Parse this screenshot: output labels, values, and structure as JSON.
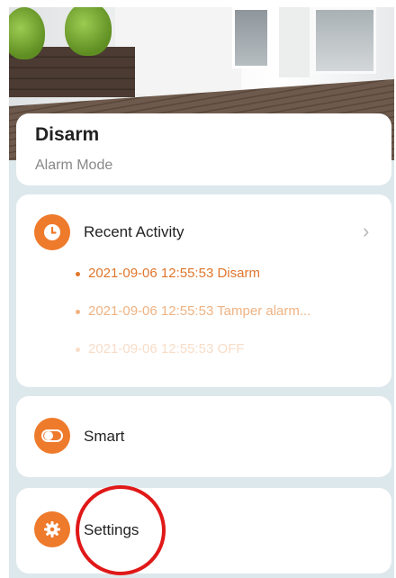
{
  "alarm": {
    "mode_value": "Disarm",
    "mode_label": "Alarm Mode"
  },
  "recent_activity": {
    "title": "Recent Activity",
    "items": [
      {
        "text": "2021-09-06 12:55:53 Disarm"
      },
      {
        "text": "2021-09-06 12:55:53 Tamper alarm..."
      },
      {
        "text": "2021-09-06 12:55:53 OFF"
      }
    ]
  },
  "smart": {
    "label": "Smart"
  },
  "settings": {
    "label": "Settings"
  },
  "icons": {
    "activity": "clock-icon",
    "smart": "toggle-icon",
    "settings": "gear-icon",
    "chevron": "chevron-right-icon"
  },
  "colors": {
    "accent": "#ee7a2b",
    "highlight": "#e01818",
    "background": "#dde8ec"
  }
}
